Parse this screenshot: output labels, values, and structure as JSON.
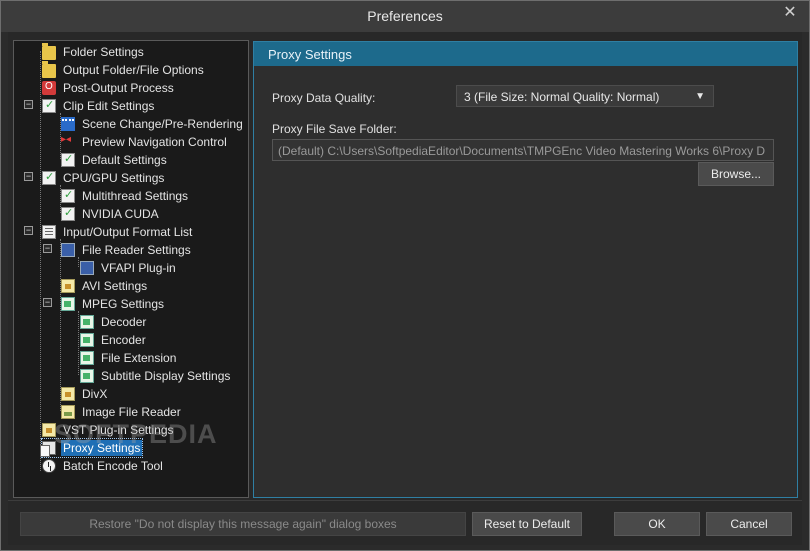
{
  "window": {
    "title": "Preferences",
    "close_glyph": "✕"
  },
  "tree": {
    "items": [
      {
        "label": "Folder Settings",
        "icon": "folder-icon"
      },
      {
        "label": "Output Folder/File Options",
        "icon": "file-options-icon"
      },
      {
        "label": "Post-Output Process",
        "icon": "post-output-icon"
      },
      {
        "label": "Clip Edit Settings",
        "icon": "check-doc-icon"
      },
      {
        "label": "Scene Change/Pre-Rendering",
        "icon": "film-icon"
      },
      {
        "label": "Preview Navigation Control",
        "icon": "navigation-icon"
      },
      {
        "label": "Default Settings",
        "icon": "check-doc-icon"
      },
      {
        "label": "CPU/GPU Settings",
        "icon": "check-doc-icon"
      },
      {
        "label": "Multithread Settings",
        "icon": "check-doc-icon"
      },
      {
        "label": "NVIDIA CUDA",
        "icon": "check-doc-icon"
      },
      {
        "label": "Input/Output Format List",
        "icon": "list-icon"
      },
      {
        "label": "File Reader Settings",
        "icon": "monitor-icon"
      },
      {
        "label": "VFAPI Plug-in",
        "icon": "monitor-icon"
      },
      {
        "label": "AVI Settings",
        "icon": "avi-icon"
      },
      {
        "label": "MPEG Settings",
        "icon": "mpeg-icon"
      },
      {
        "label": "Decoder",
        "icon": "mpeg-icon"
      },
      {
        "label": "Encoder",
        "icon": "mpeg-icon"
      },
      {
        "label": "File Extension",
        "icon": "mpeg-icon"
      },
      {
        "label": "Subtitle Display Settings",
        "icon": "mpeg-icon"
      },
      {
        "label": "DivX",
        "icon": "divx-icon"
      },
      {
        "label": "Image File Reader",
        "icon": "image-icon"
      },
      {
        "label": "VST Plug-in Settings",
        "icon": "vst-icon"
      },
      {
        "label": "Proxy Settings",
        "icon": "proxy-icon"
      },
      {
        "label": "Batch Encode Tool",
        "icon": "clock-icon"
      }
    ],
    "collapse_glyph": "−",
    "selected_index": 22
  },
  "watermark": "SOFTPEDIA",
  "panel": {
    "title": "Proxy Settings",
    "quality_label": "Proxy Data Quality:",
    "quality_value": "3 (File Size: Normal Quality: Normal)",
    "quality_arrow": "▼",
    "folder_label": "Proxy File Save Folder:",
    "folder_value": "(Default) C:\\Users\\SoftpediaEditor\\Documents\\TMPGEnc Video Mastering Works 6\\Proxy D",
    "browse_label": "Browse..."
  },
  "footer": {
    "restore_label": "Restore \"Do not display this message again\" dialog boxes",
    "reset_label": "Reset to Default",
    "ok_label": "OK",
    "cancel_label": "Cancel"
  }
}
